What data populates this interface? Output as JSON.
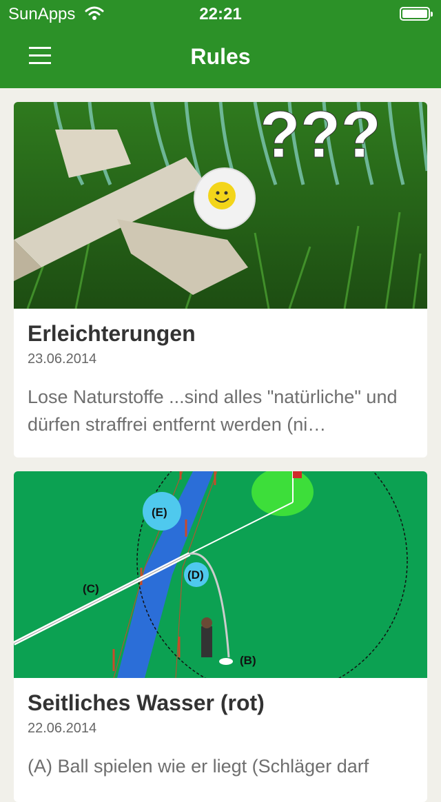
{
  "status_bar": {
    "carrier": "SunApps",
    "time": "22:21",
    "icons": [
      "wifi-icon",
      "battery-icon"
    ]
  },
  "nav": {
    "title": "Rules",
    "menu_icon": "hamburger-menu-icon"
  },
  "colors": {
    "nav_bar": "#2c9128",
    "background": "#f1f0ea",
    "card": "#ffffff"
  },
  "articles": [
    {
      "title": "Erleichterungen",
      "date": "23.06.2014",
      "excerpt": "Lose Naturstoffe ...sind alles \"natürliche\" und dürfen straffrei entfernt werden (ni…",
      "image_text": "???"
    },
    {
      "title": "Seitliches Wasser (rot)",
      "date": "22.06.2014",
      "excerpt": "(A) Ball spielen wie er liegt (Schläger darf",
      "image_labels": [
        "(E)",
        "(D)",
        "(C)",
        "(B)"
      ]
    }
  ]
}
